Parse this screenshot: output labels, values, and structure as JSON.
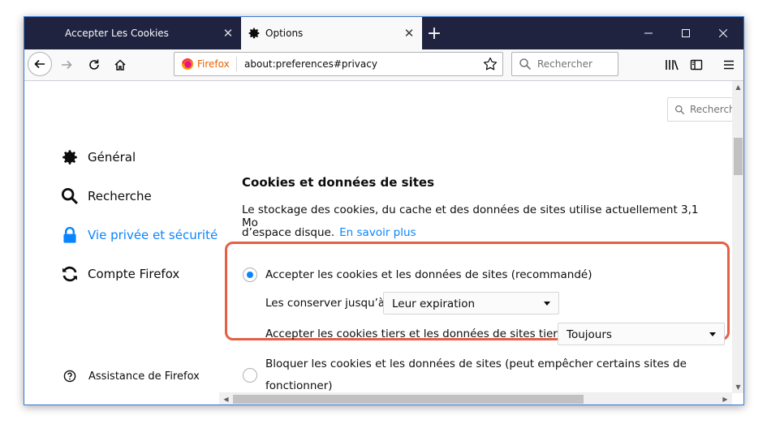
{
  "tabs": [
    {
      "label": "Accepter Les Cookies",
      "active": false
    },
    {
      "label": "Options",
      "active": true
    }
  ],
  "window_controls": {
    "minimize": "—",
    "maximize": "☐",
    "close": "✕"
  },
  "navbar": {
    "brand": "Firefox",
    "url": "about:preferences#privacy",
    "search_placeholder": "Rechercher"
  },
  "preferences_search": {
    "placeholder": "Recherch"
  },
  "sidebar": {
    "items": [
      {
        "label": "Général",
        "icon": "gear-icon",
        "selected": false
      },
      {
        "label": "Recherche",
        "icon": "search-icon",
        "selected": false
      },
      {
        "label": "Vie privée et sécurité",
        "icon": "lock-icon",
        "selected": true
      },
      {
        "label": "Compte Firefox",
        "icon": "sync-icon",
        "selected": false
      }
    ],
    "support": "Assistance de Firefox"
  },
  "cookies": {
    "title": "Cookies et données de sites",
    "desc_line1": "Le stockage des cookies, du cache et des données de sites utilise actuellement 3,1 Mo",
    "desc_line2": "d’espace disque.",
    "learn_more": "En savoir plus",
    "accept_label": "Accepter les cookies et les données de sites (recommandé)",
    "keep_until_label": "Les conserver jusqu’à",
    "keep_until_value": "Leur expiration",
    "third_party_label": "Accepter les cookies tiers et les données de sites tiers",
    "third_party_value": "Toujours",
    "block_line1": "Bloquer les cookies et les données de sites (peut empêcher certains sites de",
    "block_line2": "fonctionner)"
  },
  "colors": {
    "accent": "#0a84ff",
    "highlight": "#e65f45",
    "tabstrip": "#202340"
  }
}
